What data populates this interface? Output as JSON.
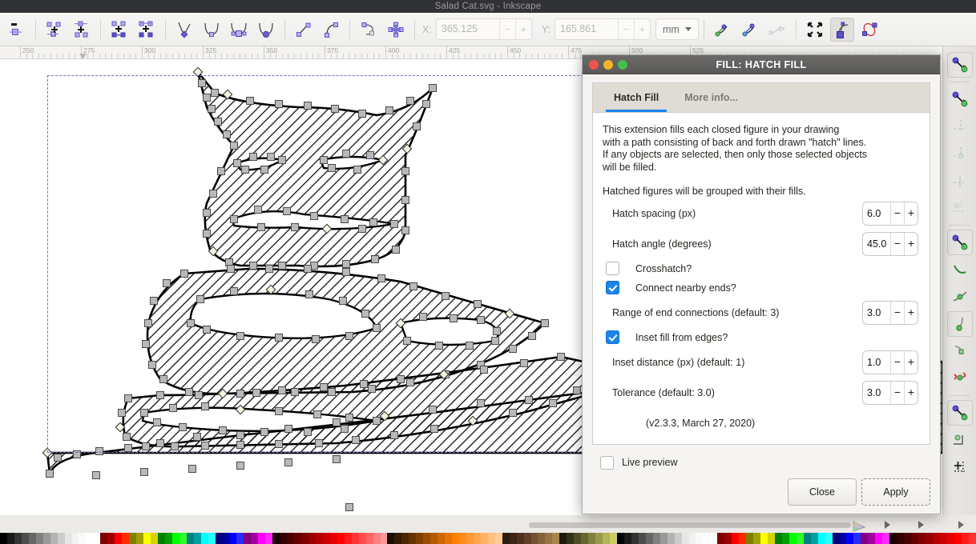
{
  "window": {
    "title": "Salad Cat.svg - Inkscape"
  },
  "toolbar": {
    "icons": [
      {
        "name": "insert-node-icon",
        "label": "Insert node"
      },
      {
        "name": "delete-node-icon",
        "label": "Delete node"
      },
      {
        "name": "break-path-icon",
        "label": "Break path at node"
      },
      {
        "name": "join-nodes-icon",
        "label": "Join selected nodes"
      },
      {
        "name": "join-with-segment-icon",
        "label": "Join with segment"
      },
      {
        "name": "delete-segment-icon",
        "label": "Delete segment"
      },
      {
        "name": "node-cusp-icon",
        "label": "Make corner"
      },
      {
        "name": "node-smooth-icon",
        "label": "Make smooth"
      },
      {
        "name": "node-symmetric-icon",
        "label": "Make symmetric"
      },
      {
        "name": "node-auto-icon",
        "label": "Make auto-smooth"
      },
      {
        "name": "segment-line-icon",
        "label": "Make line"
      },
      {
        "name": "segment-curve-icon",
        "label": "Make curve"
      },
      {
        "name": "object-to-path-icon",
        "label": "Object to path"
      },
      {
        "name": "stroke-to-path-icon",
        "label": "Stroke to path"
      }
    ],
    "x_label": "X:",
    "x_value": "365.125",
    "y_label": "Y:",
    "y_value": "165.861",
    "unit": "mm",
    "minus": "−",
    "plus": "+",
    "right_icons": [
      {
        "name": "show-transform-handles-icon",
        "label": "Show transform handles"
      },
      {
        "name": "show-bezier-handles-icon",
        "label": "Show Bezier handles"
      },
      {
        "name": "show-path-outline-icon",
        "label": "Show path outline"
      },
      {
        "name": "show-clipping-paths-icon",
        "label": "Show clipping paths"
      },
      {
        "name": "edit-mask-icon",
        "label": "Edit mask paths"
      },
      {
        "name": "edit-clip-icon",
        "label": "Edit clipping paths"
      }
    ]
  },
  "ruler": {
    "unit": "px",
    "labels": [
      "250",
      "275",
      "300",
      "325",
      "350",
      "375",
      "400",
      "425",
      "450",
      "475",
      "500",
      "525"
    ],
    "marker_position": "277"
  },
  "snapbar": {
    "items": [
      {
        "name": "snap-enable-icon",
        "active": true
      },
      {
        "name": "snap-bounding-box-icon",
        "active": false
      },
      {
        "name": "snap-bbox-edge-icon",
        "active": false
      },
      {
        "name": "snap-bbox-corner-icon",
        "active": false
      },
      {
        "name": "snap-bbox-edge-midpoint-icon",
        "active": false
      },
      {
        "name": "snap-bbox-center-icon",
        "active": false
      },
      {
        "name": "snap-nodes-icon",
        "active": true
      },
      {
        "name": "snap-path-icon",
        "active": false
      },
      {
        "name": "snap-path-intersection-icon",
        "active": false
      },
      {
        "name": "snap-cusp-node-icon",
        "active": true
      },
      {
        "name": "snap-smooth-node-icon",
        "active": false
      },
      {
        "name": "snap-midpoint-icon",
        "active": false
      },
      {
        "name": "snap-others-icon",
        "active": true
      },
      {
        "name": "snap-object-center-icon",
        "active": false
      },
      {
        "name": "snap-page-border-icon",
        "active": false
      }
    ]
  },
  "dialog": {
    "title": "FILL: HATCH FILL",
    "traffic_lights": [
      {
        "name": "close-window-button",
        "color": "#f0534c"
      },
      {
        "name": "minimize-window-button",
        "color": "#f5b428"
      },
      {
        "name": "maximize-window-button",
        "color": "#45c04c"
      }
    ],
    "tabs": [
      {
        "name": "tab-hatch-fill",
        "label": "Hatch Fill",
        "active": true
      },
      {
        "name": "tab-more-info",
        "label": "More info...",
        "active": false
      }
    ],
    "description_lines": [
      "This extension fills each closed figure in your drawing",
      "with a path consisting of back and forth drawn \"hatch\" lines.",
      "If any objects are selected, then only those selected objects",
      "will be filled."
    ],
    "description_2": "Hatched figures will be grouped with their fills.",
    "fields": [
      {
        "name": "hatch-spacing",
        "label": "Hatch spacing (px)",
        "value": "6.0"
      },
      {
        "name": "hatch-angle",
        "label": "Hatch angle (degrees)",
        "value": "45.0"
      }
    ],
    "checkbox_crosshatch": {
      "label": "Crosshatch?",
      "checked": false
    },
    "checkbox_connect": {
      "label": "Connect nearby ends?",
      "checked": true
    },
    "field_range": {
      "name": "range-of-end-connections",
      "label": "Range of end connections (default: 3)",
      "value": "3.0"
    },
    "checkbox_inset": {
      "label": "Inset fill from edges?",
      "checked": true
    },
    "field_inset": {
      "name": "inset-distance",
      "label": "Inset distance (px) (default: 1)",
      "value": "1.0"
    },
    "field_tolerance": {
      "name": "tolerance",
      "label": "Tolerance (default: 3.0)",
      "value": "3.0"
    },
    "version": "(v2.3.3, March 27, 2020)",
    "spin_minus": "−",
    "spin_plus": "+",
    "live_preview": {
      "label": "Live preview",
      "checked": false
    },
    "close_button": "Close",
    "apply_button": "Apply",
    "accent_color": "#1a84e8"
  },
  "palette": {
    "swatches": [
      "#000000",
      "#1a1a1a",
      "#333333",
      "#4d4d4d",
      "#666666",
      "#808080",
      "#999999",
      "#b3b3b3",
      "#cccccc",
      "#e6e6e6",
      "#f2f2f2",
      "#fafafa",
      "#ffffff",
      "#ffffff",
      "#800000",
      "#a00000",
      "#ff0000",
      "#ff2a00",
      "#808000",
      "#a0a000",
      "#ffff00",
      "#d4d400",
      "#008000",
      "#00a000",
      "#00ff00",
      "#2aff2a",
      "#008080",
      "#00a0a0",
      "#00ffff",
      "#2affff",
      "#000080",
      "#0000a0",
      "#0000ff",
      "#2a2aff",
      "#800080",
      "#a000a0",
      "#ff00ff",
      "#ff2aff",
      "#1a0000",
      "#330000",
      "#4d0000",
      "#660000",
      "#800000",
      "#990000",
      "#b30000",
      "#cc0000",
      "#e60000",
      "#ff0000",
      "#ff1a1a",
      "#ff3333",
      "#ff4d4d",
      "#ff6666",
      "#ff8080",
      "#ff9999",
      "#1a0d00",
      "#331a00",
      "#4d2600",
      "#663300",
      "#804000",
      "#994d00",
      "#b35900",
      "#cc6600",
      "#e67300",
      "#ff8000",
      "#ff8c1a",
      "#ff9933",
      "#ffa64d",
      "#ffb366",
      "#ffbf80",
      "#ffcc99",
      "#2b1a0e",
      "#3d2417",
      "#4f2f20",
      "#614029",
      "#735132",
      "#85623b",
      "#977344",
      "#a9844d",
      "#1a1a0d",
      "#333319",
      "#4d4d26",
      "#666633",
      "#80803f",
      "#99994c",
      "#b3b359",
      "#cccc66"
    ],
    "scroll_left_icon": "palette-scroll-left-icon",
    "scroll_right_icon": "palette-scroll-right-icon",
    "menu_icon": "palette-menu-icon"
  }
}
